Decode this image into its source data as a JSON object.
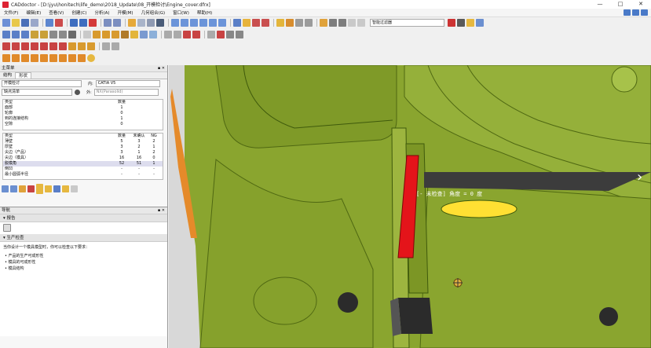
{
  "window": {
    "title": "CADdoctor - [D:\\jyu\\honitech\\life_demo\\2018_Update\\08_开模检讨\\Engine_cover.dfrx]",
    "controls": [
      "—",
      "□",
      "✕"
    ]
  },
  "menu": [
    "文件(F)",
    "编辑(E)",
    "查看(V)",
    "创建(C)",
    "分析(A)",
    "开模(M)",
    "几何组合(G)",
    "窗口(W)",
    "帮助(H)"
  ],
  "toolbar": {
    "filter_dropdown": "智能过滤器"
  },
  "main_panel": {
    "title": "主菜单",
    "tabs": [
      "结构",
      "形状"
    ],
    "mode_select": "开模检讨",
    "in_label": "内:",
    "in_value": "CATIA V5",
    "out_label": "外:",
    "out_value": "NX(Parasolid)",
    "list_select": "缺点清单",
    "table1": {
      "headers": [
        "类型",
        "数量"
      ],
      "rows": [
        [
          "面部",
          "1"
        ],
        [
          "轮廓",
          "0"
        ],
        [
          "到的连接结构",
          "1"
        ],
        [
          "空隙",
          "0"
        ]
      ]
    },
    "table2": {
      "headers": [
        "类型",
        "数量",
        "未确认",
        "NG"
      ],
      "rows": [
        [
          "薄壁",
          "5",
          "3",
          "2"
        ],
        [
          "厚壁",
          "3",
          "2",
          "1"
        ],
        [
          "尖边（产品）",
          "3",
          "1",
          "2"
        ],
        [
          "尖边（模具）",
          "16",
          "16",
          "0"
        ],
        [
          "脱模角",
          "52",
          "51",
          "1"
        ],
        [
          "倒凹",
          "-",
          "-",
          "-"
        ],
        [
          "最小圆弧半径",
          "-",
          "-",
          "-"
        ]
      ]
    }
  },
  "nav_panel": {
    "title": "导航",
    "section1": "报告",
    "section2": "生产检查",
    "intro": "当你设计一个模具模型时，你可以检查以下要求：",
    "bullets": [
      "产品的生产可成形性",
      "模具的可成形性",
      "模具结构"
    ]
  },
  "viewport": {
    "annotation": "[- 未检查] 角度 = 0 度",
    "next_arrow": "›",
    "colors": {
      "background": "#8aa52f",
      "surface": "#92ad36",
      "surface_dark": "#5f7a19",
      "ng_face": "#e4141a",
      "highlight": "#ffe033",
      "hole": "#2b2b2b",
      "edge_orange": "#e58a2a"
    }
  }
}
